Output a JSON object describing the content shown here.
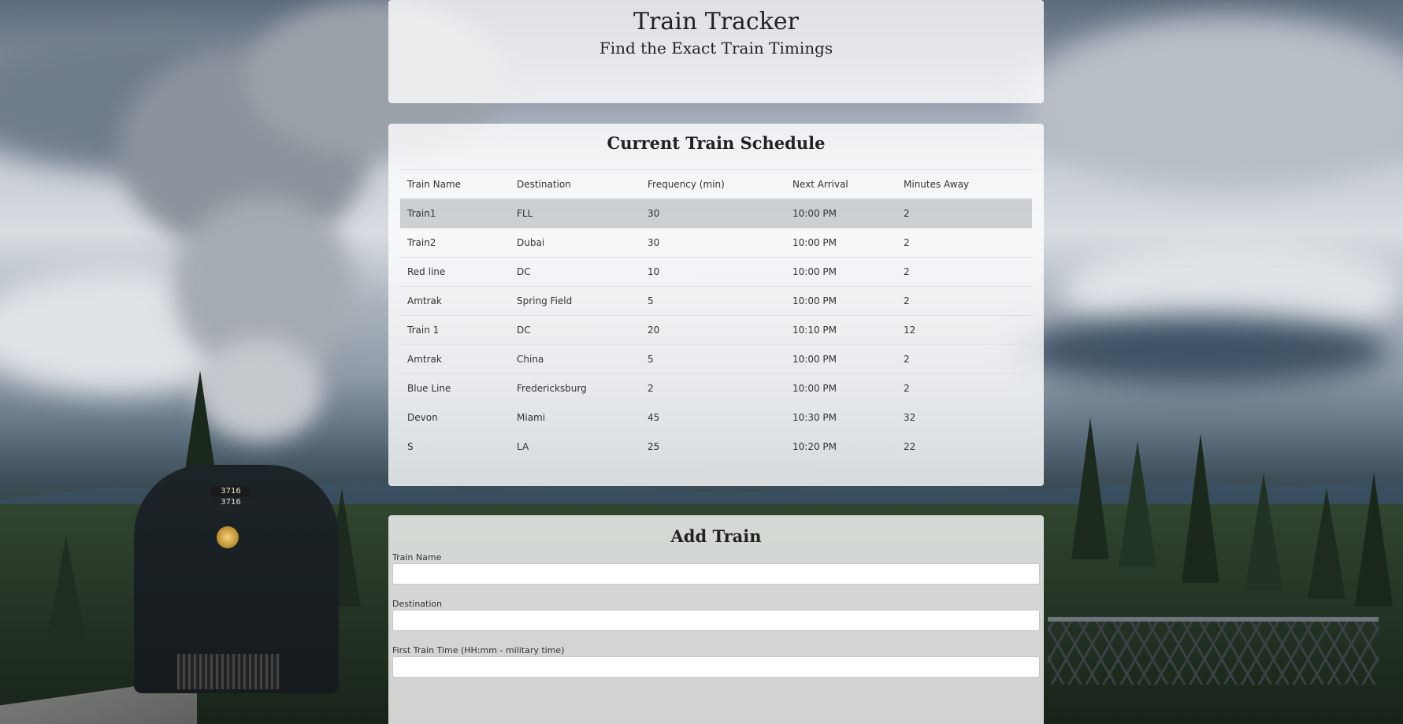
{
  "header": {
    "title": "Train Tracker",
    "subtitle": "Find the Exact Train Timings"
  },
  "schedule": {
    "heading": "Current Train Schedule",
    "columns": [
      "Train Name",
      "Destination",
      "Frequency (min)",
      "Next Arrival",
      "Minutes Away"
    ],
    "rows": [
      [
        "Train1",
        "FLL",
        "30",
        "10:00 PM",
        "2"
      ],
      [
        "Train2",
        "Dubai",
        "30",
        "10:00 PM",
        "2"
      ],
      [
        "Red line",
        "DC",
        "10",
        "10:00 PM",
        "2"
      ],
      [
        "Amtrak",
        "Spring Field",
        "5",
        "10:00 PM",
        "2"
      ],
      [
        "Train 1",
        "DC",
        "20",
        "10:10 PM",
        "12"
      ],
      [
        "Amtrak",
        "China",
        "5",
        "10:00 PM",
        "2"
      ],
      [
        "Blue Line",
        "Fredericksburg",
        "2",
        "10:00 PM",
        "2"
      ],
      [
        "Devon",
        "Miami",
        "45",
        "10:30 PM",
        "32"
      ],
      [
        "S",
        "LA",
        "25",
        "10:20 PM",
        "22"
      ]
    ]
  },
  "add_train": {
    "heading": "Add Train",
    "fields": [
      {
        "label": "Train Name",
        "value": ""
      },
      {
        "label": "Destination",
        "value": ""
      },
      {
        "label": "First Train Time (HH:mm - military time)",
        "value": ""
      }
    ]
  },
  "background": {
    "locomotive_number": "3716 3716"
  }
}
